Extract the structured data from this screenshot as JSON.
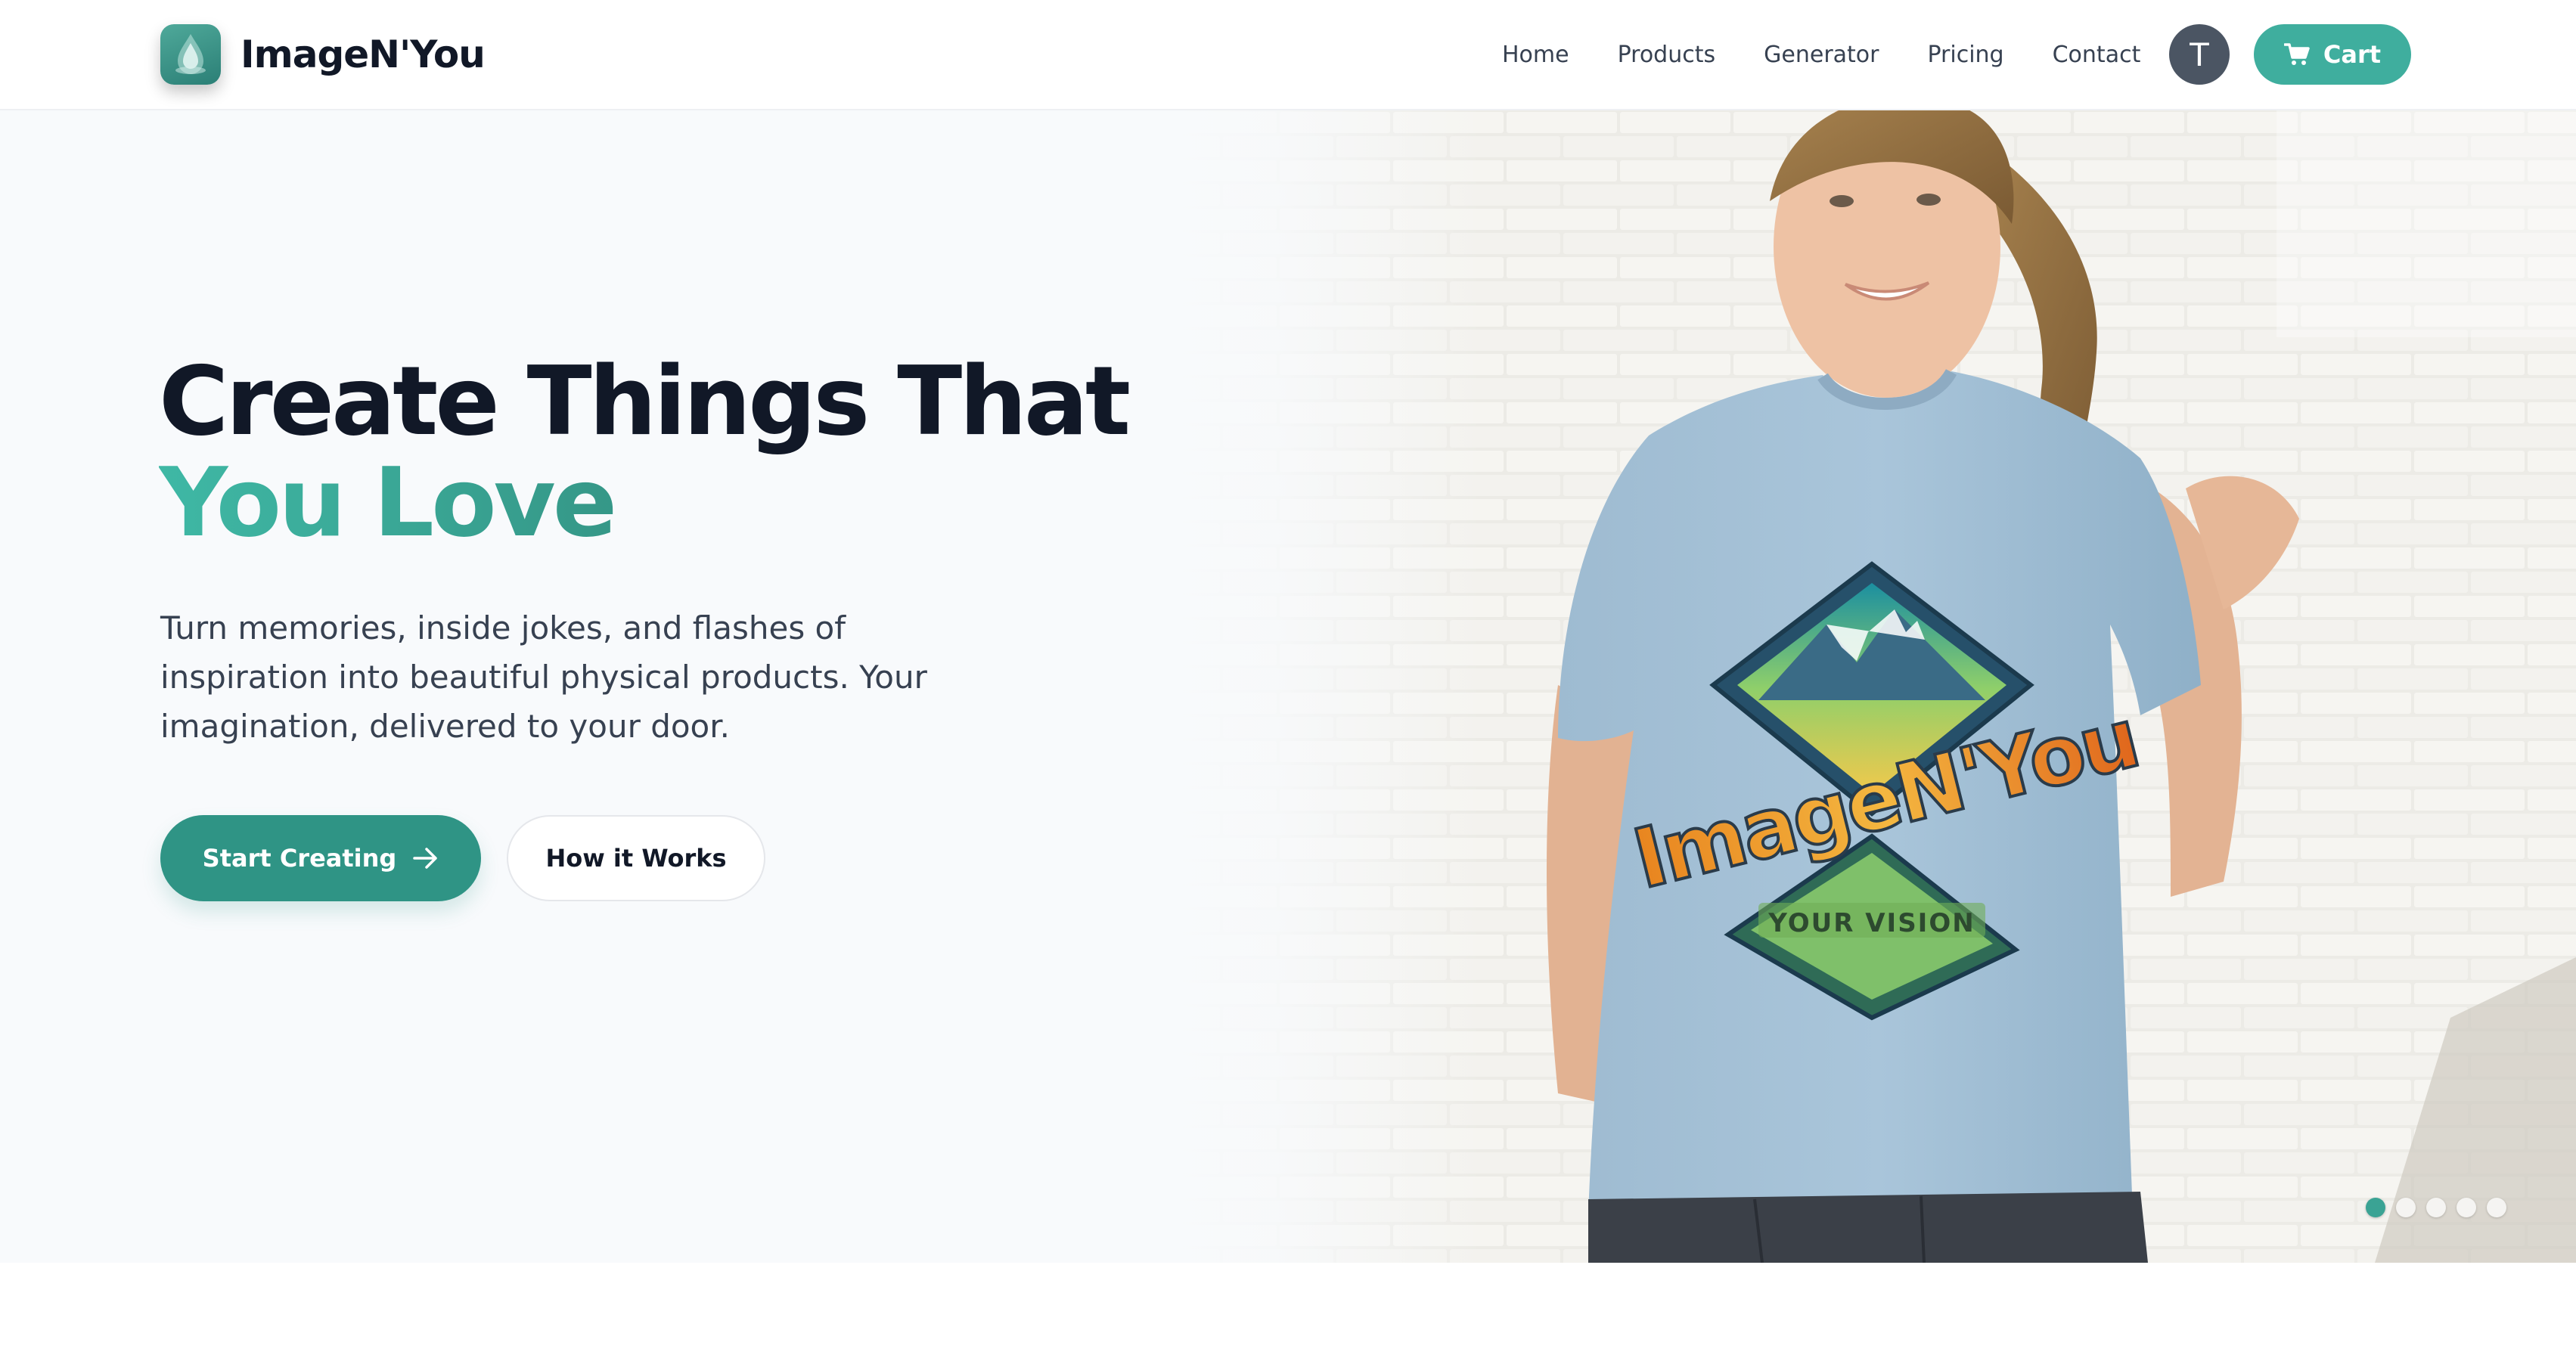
{
  "brand": {
    "name": "ImageN'You",
    "logo_icon": "water-drop-icon"
  },
  "nav": {
    "links": [
      "Home",
      "Products",
      "Generator",
      "Pricing",
      "Contact"
    ],
    "avatar_initial": "T",
    "cart_label": "Cart",
    "cart_icon": "shopping-cart-icon"
  },
  "hero": {
    "headline_line1": "Create Things That",
    "headline_line2": "You Love",
    "subtitle_lines": [
      "Turn memories, inside jokes, and flashes of",
      "inspiration into beautiful physical products. Your",
      "imagination, delivered to your door."
    ],
    "primary_cta": "Start Creating",
    "primary_cta_icon": "arrow-right-icon",
    "secondary_cta": "How it Works",
    "shirt_print_brand": "ImageN'You",
    "shirt_print_tagline": "YOUR VISION",
    "carousel": {
      "count": 5,
      "active_index": 0
    }
  },
  "colors": {
    "accent": "#3fae9e",
    "accent_dark": "#2f9485",
    "text_dark": "#111827",
    "avatar_bg": "#4b5563",
    "hero_bg": "#f8fafc"
  }
}
